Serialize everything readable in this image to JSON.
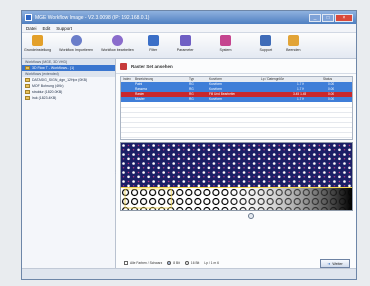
{
  "window": {
    "title": "MGE Workflow Image - V2.3.0098 (IP: 192.168.0.1)"
  },
  "menu": [
    "Datei",
    "Edit",
    "Support"
  ],
  "toolbar": [
    {
      "label": "Grundeinstellung",
      "icon": "settings-icon",
      "color": "#e3a02a"
    },
    {
      "label": "Workflow Importieren",
      "icon": "import-icon",
      "color": "#6a7dc9"
    },
    {
      "label": "Workflow bearbeiten",
      "icon": "edit-icon",
      "color": "#8a6ccc"
    },
    {
      "label": "Filter",
      "icon": "filter-icon",
      "color": "#3b6fc7"
    },
    {
      "label": "Parameter",
      "icon": "parameter-icon",
      "color": "#6f5fc4"
    },
    {
      "label": "System",
      "icon": "system-icon",
      "color": "#c5458f"
    },
    {
      "label": "Support",
      "icon": "support-icon",
      "color": "#3f6cb8"
    },
    {
      "label": "Beenden",
      "icon": "exit-icon",
      "color": "#e2a437"
    }
  ],
  "sidebar": {
    "items": [
      {
        "label": "Workflows (MGE, 3D VHD)",
        "type": "hdr"
      },
      {
        "label": "3D Flow T - Workflows.. (1)",
        "type": "sel"
      },
      {
        "label": "Workflows (extended)",
        "type": "hdr"
      },
      {
        "label": "DATASIG_SIGN_dgn_12Hpx (0KB)",
        "type": "item"
      },
      {
        "label": "MOF Bohrung (4Kb)",
        "type": "item"
      },
      {
        "label": "struktur (1820.0KB)",
        "type": "item"
      },
      {
        "label": "lruk (1823.4KB)",
        "type": "item"
      }
    ]
  },
  "content": {
    "title": "Raster Set ansehen",
    "columns": [
      "Index",
      "Bezeichnung",
      "Typ",
      "Kurzform",
      "Lp / Datengröße",
      "Status"
    ],
    "rows": [
      {
        "style": "selrow",
        "cells": [
          "",
          "Paint",
          "RG",
          "Kurzform",
          "1.7 K",
          "0.00"
        ]
      },
      {
        "style": "selrow",
        "cells": [
          "",
          "Rassera",
          "RG",
          "Kurzform",
          "1.7 K",
          "0.00"
        ]
      },
      {
        "style": "red",
        "cells": [
          "",
          "Raster",
          "RG",
          "Fill Und Bearbeiter",
          "3.45 1.45",
          "0.00"
        ]
      },
      {
        "style": "selrow",
        "cells": [
          "",
          "Muster",
          "RG",
          "Kurzform",
          "1.7 K",
          "0.00"
        ]
      }
    ],
    "empty_rows": 8
  },
  "bottom": {
    "checkbox_label": "Alle Farben / Schwarz",
    "radio1": "8 Bit",
    "radio2": "16 Bit",
    "field": "Lp / 1 m 6",
    "next": "Weiter"
  }
}
